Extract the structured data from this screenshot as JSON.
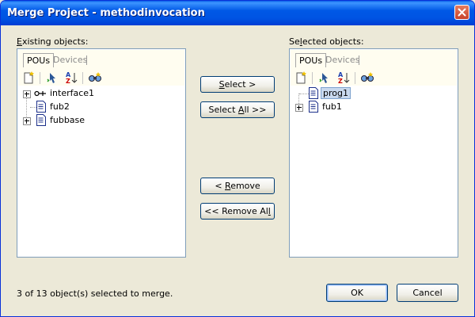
{
  "window": {
    "title": "Merge Project - methodinvocation",
    "close_label": "×"
  },
  "left_panel": {
    "label_first": "E",
    "label_rest": "xisting objects:",
    "tabs": [
      {
        "label": "POUs",
        "active": true
      },
      {
        "label": "Devices",
        "active": false
      }
    ],
    "toolbar_icons": [
      "new-object-icon",
      "properties-icon",
      "sort-az-icon",
      "find-icon"
    ],
    "items": [
      {
        "label": "interface1",
        "icon": "interface-icon",
        "expandable": true
      },
      {
        "label": "fub2",
        "icon": "pou-document-icon",
        "expandable": false
      },
      {
        "label": "fubbase",
        "icon": "pou-document-icon",
        "expandable": true
      }
    ]
  },
  "right_panel": {
    "label_pre": "Se",
    "label_u": "l",
    "label_post": "ected objects:",
    "tabs": [
      {
        "label": "POUs",
        "active": true
      },
      {
        "label": "Devices",
        "active": false
      }
    ],
    "items": [
      {
        "label": "prog1",
        "icon": "pou-document-icon",
        "expandable": false,
        "selected": true
      },
      {
        "label": "fub1",
        "icon": "pou-document-icon",
        "expandable": true,
        "selected": false
      }
    ]
  },
  "buttons": {
    "select_u": "S",
    "select_rest": "elect >",
    "select_all_pre": "Select ",
    "select_all_u": "A",
    "select_all_post": "ll >>",
    "remove_pre": "< ",
    "remove_u": "R",
    "remove_post": "emove",
    "remove_all_pre": "<< Remove Al",
    "remove_all_u": "l",
    "ok": "OK",
    "cancel": "Cancel"
  },
  "status": "3 of 13 object(s) selected to merge.",
  "colors": {
    "titlebar": "#0054e3",
    "dialog_bg": "#ece9d8",
    "border": "#7f9db9",
    "selection": "#c9d9ee"
  }
}
